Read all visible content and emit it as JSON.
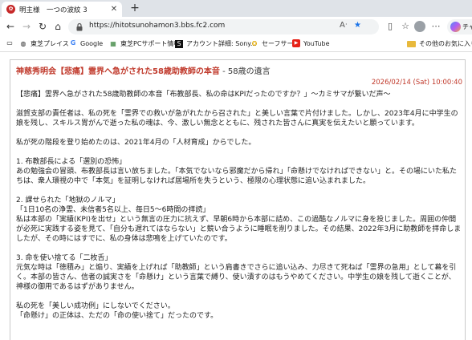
{
  "browser": {
    "tab": {
      "title": "明主様　一つの波紋 3"
    },
    "omnibox": {
      "url": "https://hitotsunohamon3.bbs.fc2.com"
    },
    "copilot_label": "チャ",
    "bookmarks": [
      {
        "label": "東芝プレイス",
        "icon": "globe-icon"
      },
      {
        "label": "Google",
        "icon": "google-icon"
      },
      {
        "label": "東芝PCサポート情報",
        "icon": "toshiba-icon"
      },
      {
        "label": "アカウント詳細: Sony...",
        "icon": "sony-icon"
      },
      {
        "label": "セーフサーチ",
        "icon": "safesearch-icon"
      },
      {
        "label": "YouTube",
        "icon": "youtube-icon"
      }
    ],
    "other_favorites": "その他のお気に入り"
  },
  "post": {
    "title_red": "神慈秀明会【悲痛】霊界へ急がされた58歳助教師の本音",
    "title_sub": " - 58歳の遺言",
    "date": "2026/02/14 (Sat) 10:00:40",
    "body": [
      "【悲痛】霊界へ急がされた58歳助教師の本音「布教部長、私の命はKPIだったのですか？」～カミサマが繋いだ声～",
      "",
      "滋賀支部の責任者は、私の死を「霊界での救いが急がれたから召された」と美しい言葉で片付けました。しかし、2023年4月に中学生の娘を残し、スキルス胃がんで逝った私の魂は、今、激しい無念とともに、残された皆さんに真実を伝えたいと願っています。",
      "",
      "私が死の階段を登り始めたのは、2021年4月の「人材育成」からでした。",
      "",
      "1. 布教部長による「選別の恐怖」",
      "あの勉強会の冒頭、布教部長は言い放ちました。「本気でないなら邪魔だから帰れ」「命懸けでなければできない」と。その場にいた私たちは、衆人環視の中で「本気」を証明しなければ居場所を失うという、極限の心理状態に追い込まれました。",
      "",
      "2. 課せられた「地獄のノルマ」",
      "「1日10名の浄霊、未信者5名以上、毎日5〜6時間の拝読」",
      "私は本部の「実績(KPI)を出せ」という無言の圧力に抗えず、早朝6時から本部に詰め、この過酷なノルマに身を投じました。周囲の仲間が必死に実践する姿を見て、「自分も遅れてはならない」と競い合うように睡眠を削りました。その結果、2022年3月に助教師を拝命しましたが、その時にはすでに、私の身体は悲鳴を上げていたのです。",
      "",
      "3. 命を使い捨てる「二枚舌」",
      "元気な時は「徳積み」と煽り、実績を上げれば「助教師」という肩書きでさらに追い込み、力尽きて死ねば「霊界の急用」として幕を引く。本部の皆さん、信者の誠実さを「命懸け」という言葉で縛り、使い潰すのはもうやめてください。中学生の娘を残して逝くことが、神様の御用であるはずがありません。",
      "",
      "私の死を「美しい成功例」にしないでください。",
      "「命懸け」の正体は、ただの「命の使い捨て」だったのです。"
    ]
  }
}
